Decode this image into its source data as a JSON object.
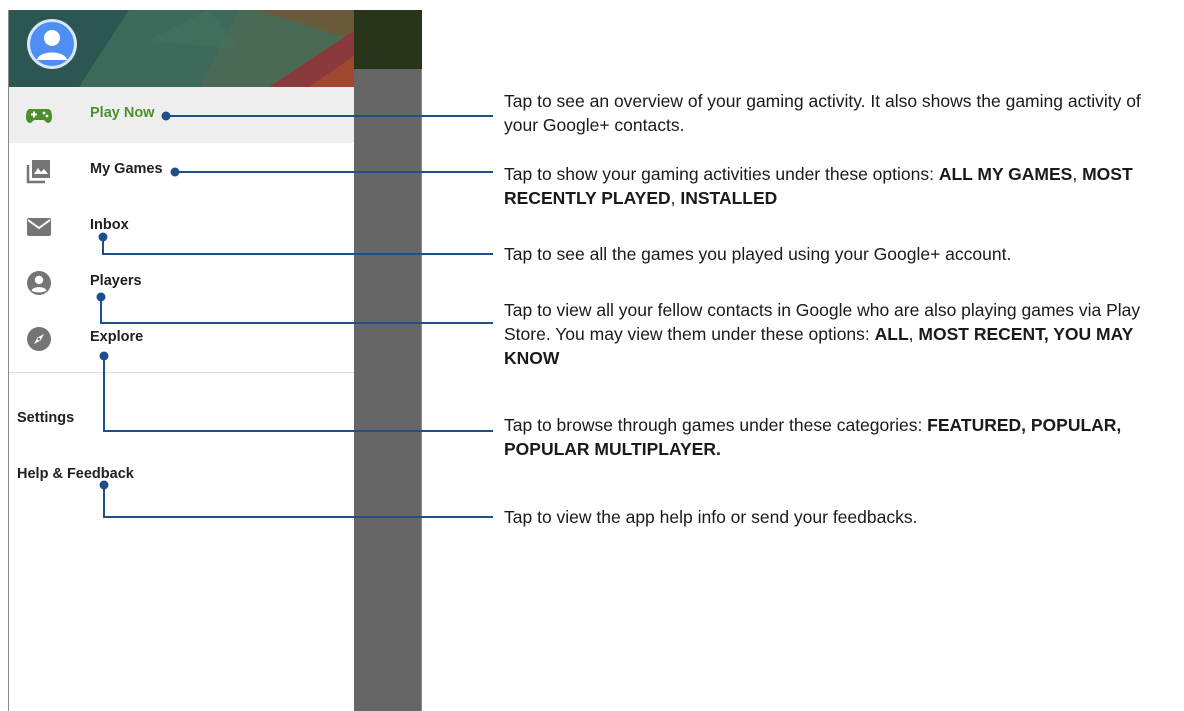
{
  "menu": {
    "items": [
      {
        "label": "Play Now",
        "icon": "gamepad-icon",
        "active": true
      },
      {
        "label": "My Games",
        "icon": "game-library-icon"
      },
      {
        "label": "Inbox",
        "icon": "mail-icon"
      },
      {
        "label": "Players",
        "icon": "person-icon"
      },
      {
        "label": "Explore",
        "icon": "compass-icon"
      }
    ],
    "footer": [
      {
        "label": "Settings"
      },
      {
        "label": "Help & Feedback"
      }
    ]
  },
  "callouts": [
    {
      "parts": [
        {
          "t": "Tap to see an overview of your gaming activity. It also shows the gaming activity of your  Google+ contacts."
        }
      ]
    },
    {
      "parts": [
        {
          "t": "Tap to show your gaming activities under these options: "
        },
        {
          "t": "ALL MY GAMES",
          "b": true
        },
        {
          "t": ", "
        },
        {
          "t": "MOST RECENTLY PLAYED",
          "b": true
        },
        {
          "t": ", "
        },
        {
          "t": "INSTALLED",
          "b": true
        }
      ]
    },
    {
      "parts": [
        {
          "t": "Tap to see all the games you played using your Google+ account."
        }
      ]
    },
    {
      "parts": [
        {
          "t": "Tap to view all your fellow contacts in Google who are also playing games via Play Store. You may view them under these options: "
        },
        {
          "t": "ALL",
          "b": true
        },
        {
          "t": ", "
        },
        {
          "t": "MOST RECENT, YOU MAY KNOW",
          "b": true
        }
      ]
    },
    {
      "parts": [
        {
          "t": "Tap to browse through games under these categories: "
        },
        {
          "t": "FEATURED, POPULAR, POPULAR MULTIPLAYER.",
          "b": true
        }
      ]
    },
    {
      "parts": [
        {
          "t": "Tap to view the app help info or send your feedbacks."
        }
      ]
    }
  ],
  "colors": {
    "accent_green": "#4e8f2d",
    "callout_line": "#1f4e8c",
    "scrim": "#666666"
  }
}
